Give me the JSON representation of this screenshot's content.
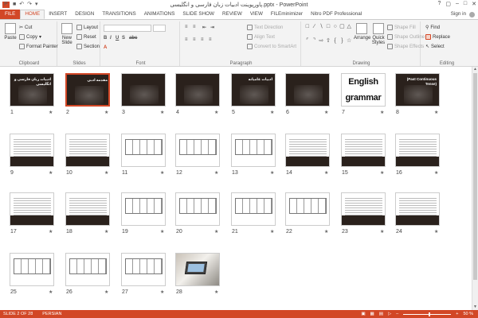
{
  "window": {
    "title": "پاورپوینت ادبیات زبان فارسی و انگلیسی.pptx - PowerPoint",
    "sign_in": "Sign in"
  },
  "tabs": [
    "FILE",
    "HOME",
    "INSERT",
    "DESIGN",
    "TRANSITIONS",
    "ANIMATIONS",
    "SLIDE SHOW",
    "REVIEW",
    "VIEW",
    "FILEminimizer",
    "Nitro PDF Professional"
  ],
  "ribbon": {
    "clipboard": {
      "label": "Clipboard",
      "paste": "Paste",
      "cut": "Cut",
      "copy": "Copy",
      "format_painter": "Format Painter"
    },
    "slides": {
      "label": "Slides",
      "new_slide": "New Slide",
      "layout": "Layout",
      "reset": "Reset",
      "section": "Section"
    },
    "font": {
      "label": "Font"
    },
    "paragraph": {
      "label": "Paragraph",
      "text_direction": "Text Direction",
      "align_text": "Align Text",
      "convert": "Convert to SmartArt"
    },
    "drawing": {
      "label": "Drawing",
      "arrange": "Arrange",
      "quick_styles": "Quick Styles",
      "shape_fill": "Shape Fill",
      "shape_outline": "Shape Outline",
      "shape_effects": "Shape Effects"
    },
    "editing": {
      "label": "Editing",
      "find": "Find",
      "replace": "Replace",
      "select": "Select"
    }
  },
  "slides": [
    {
      "n": "1",
      "kind": "dark",
      "title": "ادبیات زبان فارسی و انگلیسی"
    },
    {
      "n": "2",
      "kind": "dark",
      "title": "مقدمه ادبی",
      "selected": true
    },
    {
      "n": "3",
      "kind": "dark",
      "title": ""
    },
    {
      "n": "4",
      "kind": "dark",
      "title": ""
    },
    {
      "n": "5",
      "kind": "dark",
      "title": "ادبیات عامیانه"
    },
    {
      "n": "6",
      "kind": "dark",
      "title": ""
    },
    {
      "n": "7",
      "kind": "english",
      "title": ""
    },
    {
      "n": "8",
      "kind": "dark",
      "title": "(Past Continuous Tense)"
    },
    {
      "n": "9",
      "kind": "doc",
      "title": ""
    },
    {
      "n": "10",
      "kind": "doc",
      "title": ""
    },
    {
      "n": "11",
      "kind": "doctable",
      "title": ""
    },
    {
      "n": "12",
      "kind": "doctable",
      "title": ""
    },
    {
      "n": "13",
      "kind": "doctable",
      "title": ""
    },
    {
      "n": "14",
      "kind": "doc",
      "title": ""
    },
    {
      "n": "15",
      "kind": "docdark",
      "title": ""
    },
    {
      "n": "16",
      "kind": "docdark",
      "title": ""
    },
    {
      "n": "17",
      "kind": "doc",
      "title": ""
    },
    {
      "n": "18",
      "kind": "doc",
      "title": ""
    },
    {
      "n": "19",
      "kind": "doctable",
      "title": ""
    },
    {
      "n": "20",
      "kind": "doctable",
      "title": ""
    },
    {
      "n": "21",
      "kind": "doctable",
      "title": ""
    },
    {
      "n": "22",
      "kind": "doctable",
      "title": ""
    },
    {
      "n": "23",
      "kind": "docdark",
      "title": ""
    },
    {
      "n": "24",
      "kind": "docdark",
      "title": ""
    },
    {
      "n": "25",
      "kind": "doctable",
      "title": ""
    },
    {
      "n": "26",
      "kind": "doctable",
      "title": ""
    },
    {
      "n": "27",
      "kind": "doctable",
      "title": ""
    },
    {
      "n": "28",
      "kind": "photo",
      "title": ""
    }
  ],
  "english_slide": {
    "line1": "English",
    "line2": "grammar"
  },
  "status": {
    "slide_of": "SLIDE 2 OF 28",
    "language": "PERSIAN",
    "zoom": "50 %"
  },
  "colors": {
    "accent": "#d24726",
    "slide_bg": "#2a211c"
  }
}
